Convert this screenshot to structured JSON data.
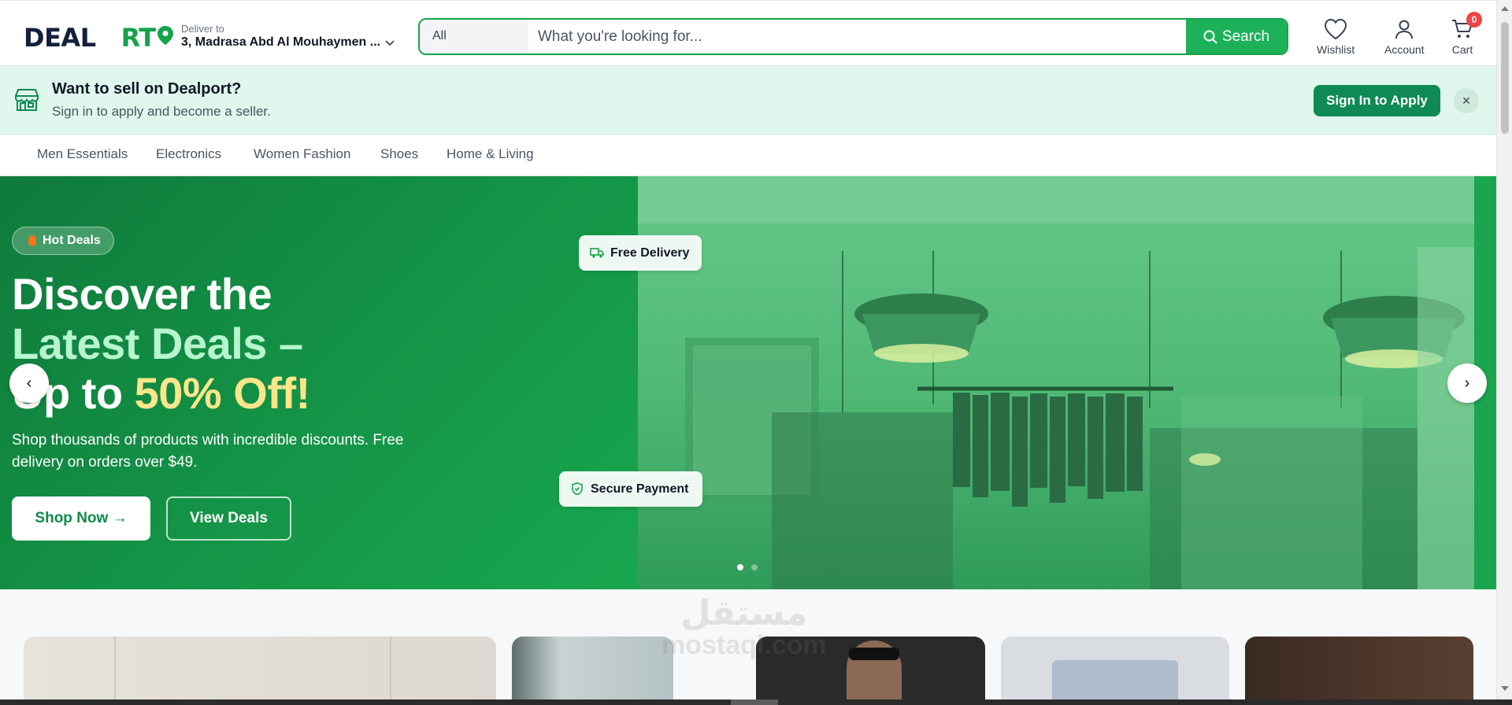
{
  "header": {
    "logo_text": "DEALPORT",
    "deliver": {
      "label": "Deliver to",
      "address": "3, Madrasa Abd Al Mouhaymen ..."
    },
    "search": {
      "category": "All",
      "placeholder": "What you're looking for...",
      "button_label": "Search"
    },
    "wishlist_label": "Wishlist",
    "account_label": "Account",
    "cart_label": "Cart",
    "cart_count": "0"
  },
  "seller_banner": {
    "title": "Want to sell on Dealport?",
    "subtitle": "Sign in to apply and become a seller.",
    "button_label": "Sign In to Apply",
    "close_glyph": "×"
  },
  "categories": [
    "Men Essentials",
    "Electronics",
    "Women Fashion",
    "Shoes",
    "Home & Living"
  ],
  "hero": {
    "badge": "Hot Deals",
    "headline_1": "Discover the",
    "headline_2": "Latest Deals –",
    "headline_3a": "Up to ",
    "headline_3b": "50% Off!",
    "subtitle": "Shop thousands of products with incredible discounts. Free delivery on orders over $49.",
    "shop_button": "Shop Now →",
    "view_button": "View Deals",
    "pill_delivery": "Free Delivery",
    "pill_payment": "Secure Payment",
    "prev_glyph": "‹",
    "next_glyph": "›",
    "active_slide": 1,
    "slide_count": 2
  },
  "watermark": {
    "arabic": "مستقل",
    "latin": "mostaql.com"
  },
  "colors": {
    "brand_green": "#16a34a",
    "apply_green": "#0f8a55",
    "hero_green": "#139047",
    "badge_red": "#ef4444",
    "highlight_yellow": "#fde68a"
  }
}
